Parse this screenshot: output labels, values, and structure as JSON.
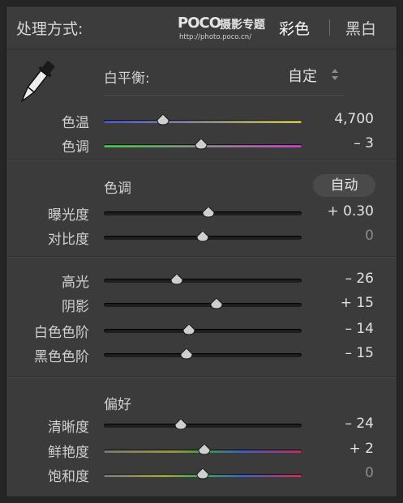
{
  "header": {
    "title": "处理方式:",
    "watermark_brand": "POCO",
    "watermark_cn": "摄影专题",
    "watermark_url": "http://photo.poco.cn/",
    "tab_color": "彩色",
    "tab_bw": "黑白"
  },
  "white_balance": {
    "label": "白平衡:",
    "value": "自定",
    "icon": "eyedropper-icon"
  },
  "sliders_wb": [
    {
      "label": "色温",
      "value": "4,700",
      "position": 0.3,
      "track": "temperature"
    },
    {
      "label": "色调",
      "value": "– 3",
      "position": 0.49,
      "track": "tint"
    }
  ],
  "tone": {
    "title": "色调",
    "auto": "自动",
    "sliders": [
      {
        "label": "曝光度",
        "value": "+ 0.30",
        "position": 0.53
      },
      {
        "label": "对比度",
        "value": "0",
        "position": 0.5,
        "dim": true
      }
    ]
  },
  "tone2": {
    "sliders": [
      {
        "label": "高光",
        "value": "– 26",
        "position": 0.37
      },
      {
        "label": "阴影",
        "value": "+ 15",
        "position": 0.57
      },
      {
        "label": "白色色阶",
        "value": "– 14",
        "position": 0.43
      },
      {
        "label": "黑色色阶",
        "value": "– 15",
        "position": 0.42
      }
    ]
  },
  "presence": {
    "title": "偏好",
    "sliders": [
      {
        "label": "清晰度",
        "value": "– 24",
        "position": 0.39,
        "track": "plain"
      },
      {
        "label": "鲜艳度",
        "value": "+ 2",
        "position": 0.51,
        "track": "vibrance"
      },
      {
        "label": "饱和度",
        "value": "0",
        "position": 0.5,
        "track": "saturation",
        "dim": true
      }
    ]
  },
  "colors": {
    "panel_bg": "#3b3b3b",
    "temp_start": "#4a52c8",
    "temp_end": "#c8c24a",
    "tint_start": "#3fc44a",
    "tint_end": "#c040c0"
  }
}
